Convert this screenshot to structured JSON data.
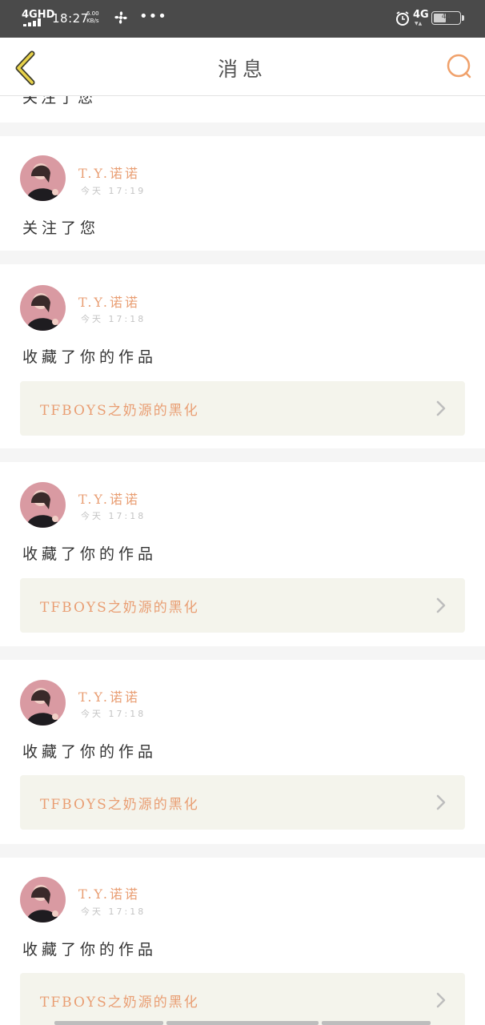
{
  "status_bar": {
    "network": "4GHD",
    "time": "18:27",
    "speed_value": "6.00",
    "speed_unit": "KB/s",
    "more": "•••",
    "network_right": "4G",
    "battery": "44"
  },
  "nav": {
    "title": "消息",
    "accent_color": "#f0a16b",
    "back_icon": "chevron-left-icon",
    "search_icon": "search-icon"
  },
  "partial_item": {
    "action": "关注了您"
  },
  "messages": [
    {
      "user": "T.Y.诺诺",
      "time": "今天 17:19",
      "action": "关注了您"
    },
    {
      "user": "T.Y.诺诺",
      "time": "今天 17:18",
      "action": "收藏了你的作品",
      "work_title": "TFBOYS之奶源的黑化"
    },
    {
      "user": "T.Y.诺诺",
      "time": "今天 17:18",
      "action": "收藏了你的作品",
      "work_title": "TFBOYS之奶源的黑化"
    },
    {
      "user": "T.Y.诺诺",
      "time": "今天 17:18",
      "action": "收藏了你的作品",
      "work_title": "TFBOYS之奶源的黑化"
    },
    {
      "user": "T.Y.诺诺",
      "time": "今天 17:18",
      "action": "收藏了你的作品",
      "work_title": "TFBOYS之奶源的黑化"
    }
  ]
}
